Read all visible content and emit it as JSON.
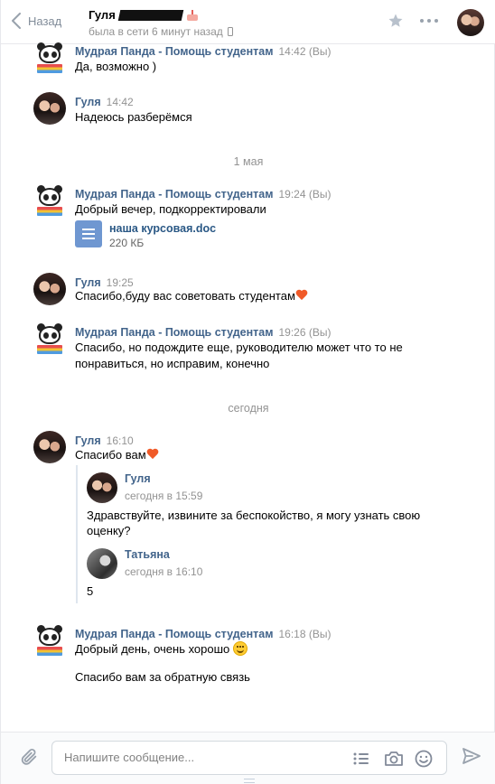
{
  "header": {
    "back_label": "Назад",
    "peer_name": "Гуля",
    "peer_status": "была в сети 6 минут назад"
  },
  "messages": [
    {
      "author": "Мудрая Панда - Помощь студентам",
      "time": "14:42 (Вы)",
      "text": "Да, возможно )"
    },
    {
      "author": "Гуля",
      "time": "14:42",
      "text": "Надеюсь разберёмся"
    },
    {
      "author": "Мудрая Панда - Помощь студентам",
      "time": "19:24 (Вы)",
      "text": "Добрый вечер, подкорректировали",
      "attachment": {
        "name": "наша курсовая.doc",
        "size": "220 КБ"
      }
    },
    {
      "author": "Гуля",
      "time": "19:25",
      "text": "Спасибо,буду вас советовать студентам"
    },
    {
      "author": "Мудрая Панда - Помощь студентам",
      "time": "19:26 (Вы)",
      "text": "Спасибо, но подождите еще, руководителю может что то не понравиться, но исправим, конечно"
    },
    {
      "author": "Гуля",
      "time": "16:10",
      "text": "Спасибо вам"
    },
    {
      "author": "Мудрая Панда - Помощь студентам",
      "time": "16:18 (Вы)",
      "text": "Добрый день, очень хорошо",
      "text2": "Спасибо вам за обратную связь"
    }
  ],
  "date_separators": [
    "1 мая",
    "сегодня"
  ],
  "forwarded": [
    {
      "author": "Гуля",
      "date": "сегодня в 15:59",
      "text": "Здравствуйте, извините за беспокойство, я могу узнать свою оценку?"
    },
    {
      "author": "Татьяна",
      "date": "сегодня в 16:10",
      "text": "5"
    }
  ],
  "composer": {
    "placeholder": "Напишите сообщение..."
  },
  "colors": {
    "link": "#42648b",
    "muted": "#939393",
    "accent": "#5181b8"
  }
}
